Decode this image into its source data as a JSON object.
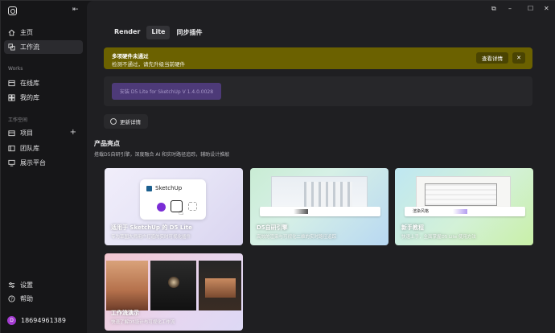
{
  "window": {
    "controls": [
      "⧉",
      "–",
      "☐",
      "✕"
    ]
  },
  "sidebar": {
    "main_items": [
      {
        "label": "主页",
        "icon": "home-icon"
      },
      {
        "label": "工作流",
        "icon": "workflow-icon",
        "active": true
      }
    ],
    "works_title": "Works",
    "works_items": [
      {
        "label": "在线库",
        "icon": "online-library-icon"
      },
      {
        "label": "我的库",
        "icon": "my-library-icon"
      }
    ],
    "workspace_title": "工作空间",
    "workspace_items": [
      {
        "label": "项目",
        "icon": "project-icon"
      },
      {
        "label": "团队库",
        "icon": "team-library-icon"
      },
      {
        "label": "展示平台",
        "icon": "showcase-icon"
      }
    ],
    "bottom_items": [
      {
        "label": "设置",
        "icon": "settings-icon"
      },
      {
        "label": "帮助",
        "icon": "help-icon"
      }
    ],
    "user": {
      "avatar_letter": "D",
      "name": "18694961389"
    }
  },
  "tabs": [
    {
      "label": "Render",
      "active": false
    },
    {
      "label": "Lite",
      "active": true
    },
    {
      "label": "同步插件",
      "active": false
    }
  ],
  "alert": {
    "title": "多项硬件未通过",
    "subtitle": "检测不通过，请先升级当前硬件",
    "action": "查看详情",
    "close": "✕"
  },
  "install": {
    "label": "安装 D5 Lite for SketchUp V 1.4.0.0028"
  },
  "update": {
    "label": "更新详情"
  },
  "highlights": {
    "title": "产品亮点",
    "subtitle": "搭载D5自研引擎，深度融合 AI 和实时路径追踪，辅助设计推敲"
  },
  "cards": [
    {
      "title": "适用于 SketchUp 的 D5 Lite",
      "desc": "专为草图大师用户打造的实时可视化插件",
      "sketchup_label": "SketchUp"
    },
    {
      "title": "D5自研引擎",
      "desc": "高效的渲染与可视化二维的实时路径追踪"
    },
    {
      "title": "新手教程",
      "desc": "快速上手，全面掌握D5 Lite 使用方法",
      "toolbar_label": "渲染风格"
    },
    {
      "title": "工作流演示",
      "desc": "快速了解D5设计与可视化工作流"
    }
  ],
  "colors": {
    "accent": "#a33bd1",
    "alert_bg": "#6b6100",
    "install_bg": "#4d3a78"
  }
}
